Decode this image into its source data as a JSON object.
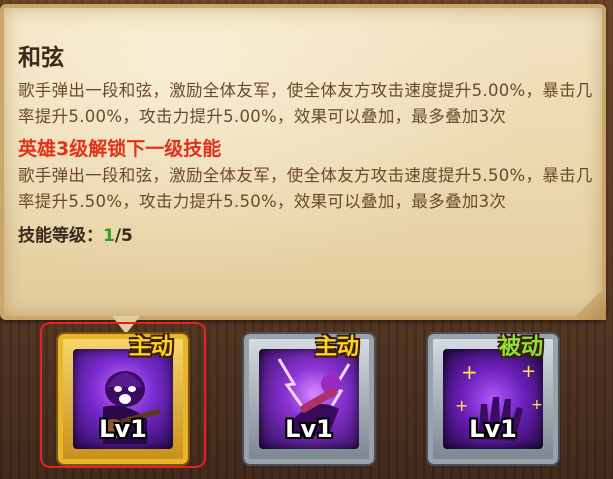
{
  "tooltip": {
    "skill_name": "和弦",
    "current_desc": "歌手弹出一段和弦，激励全体友军，使全体友方攻击速度提升5.00%，暴击几率提升5.00%，攻击力提升5.00%，效果可以叠加，最多叠加3次",
    "next_unlock_header": "英雄3级解锁下一级技能",
    "next_desc": "歌手弹出一段和弦，激励全体友军，使全体友方攻击速度提升5.50%，暴击几率提升5.50%，攻击力提升5.50%，效果可以叠加，最多叠加3次",
    "level_label": "技能等级：",
    "level_current": "1",
    "level_max": "/5"
  },
  "skills": [
    {
      "tag": "主动",
      "level": "Lv1",
      "type": "active",
      "selected": true
    },
    {
      "tag": "主动",
      "level": "Lv1",
      "type": "active",
      "selected": false
    },
    {
      "tag": "被动",
      "level": "Lv1",
      "type": "passive",
      "selected": false
    }
  ],
  "colors": {
    "parchment": "#ead7ad",
    "title_text": "#3a2a18",
    "desc_text": "#6b4a2b",
    "unlock_red": "#e0321c",
    "level_green": "#2f9d2b",
    "active_tag": "#ffd21e",
    "passive_tag": "#8ee03a",
    "selection_outline": "#e42222"
  }
}
